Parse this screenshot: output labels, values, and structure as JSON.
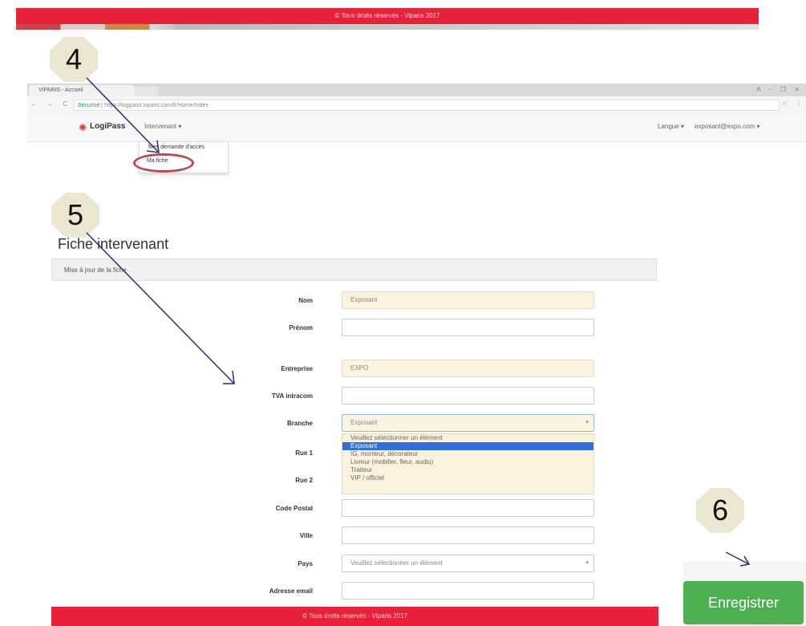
{
  "footer_text": "© Tous droits réservés - Viparis 2017",
  "steps": [
    "4",
    "5",
    "6"
  ],
  "browser": {
    "tab_title": "VIPARIS - Accueil",
    "nav_buttons": "← → C ⌂",
    "secure_label": "Sécurisé",
    "url": "https://logipass.viparis.com/fr/Home/Index",
    "window_controls": "A – ❐ ✕",
    "url_icons": "☆ ⋮"
  },
  "navbar": {
    "logo": "LogiPass",
    "intervenant_menu": "Intervenant ▾",
    "langue_menu": "Langue ▾",
    "user_menu": "exposant@expo.com ▾"
  },
  "dropdown_items": [
    "Mes demande d'accès",
    "Ma fiche"
  ],
  "form": {
    "title": "Fiche intervenant",
    "panel_heading": "Mise à jour de la fiche",
    "fields": [
      {
        "label": "Nom",
        "value": "Exposant"
      },
      {
        "label": "Prénom",
        "value": ""
      },
      {
        "label": "Entreprise",
        "value": "EXPO"
      },
      {
        "label": "TVA intracom",
        "value": ""
      },
      {
        "label": "Branche",
        "value": "Exposant"
      },
      {
        "label": "Rue 1",
        "value": ""
      },
      {
        "label": "Rue 2",
        "value": ""
      },
      {
        "label": "Code Postal",
        "value": ""
      },
      {
        "label": "Ville",
        "value": ""
      },
      {
        "label": "Pays",
        "value": "Veuillez sélectionner un élément"
      },
      {
        "label": "Adresse email",
        "value": ""
      }
    ],
    "branche_options": [
      "Veuillez sélectionner un élément",
      "Exposant",
      "IG, monteur, décorateur",
      "Livreur (mobilier, fleur, audio)",
      "Traiteur",
      "VIP / officiel"
    ],
    "branche_selected_index": 1
  },
  "save_button": "Enregistrer",
  "colors": {
    "footer_red": "#e8203a",
    "badge": "#ebe6cf",
    "annotation_arrow": "#2e2a7a",
    "highlight_circle": "#b84a50",
    "save_green": "#4cb050",
    "selected_option": "#2f6fe0"
  }
}
